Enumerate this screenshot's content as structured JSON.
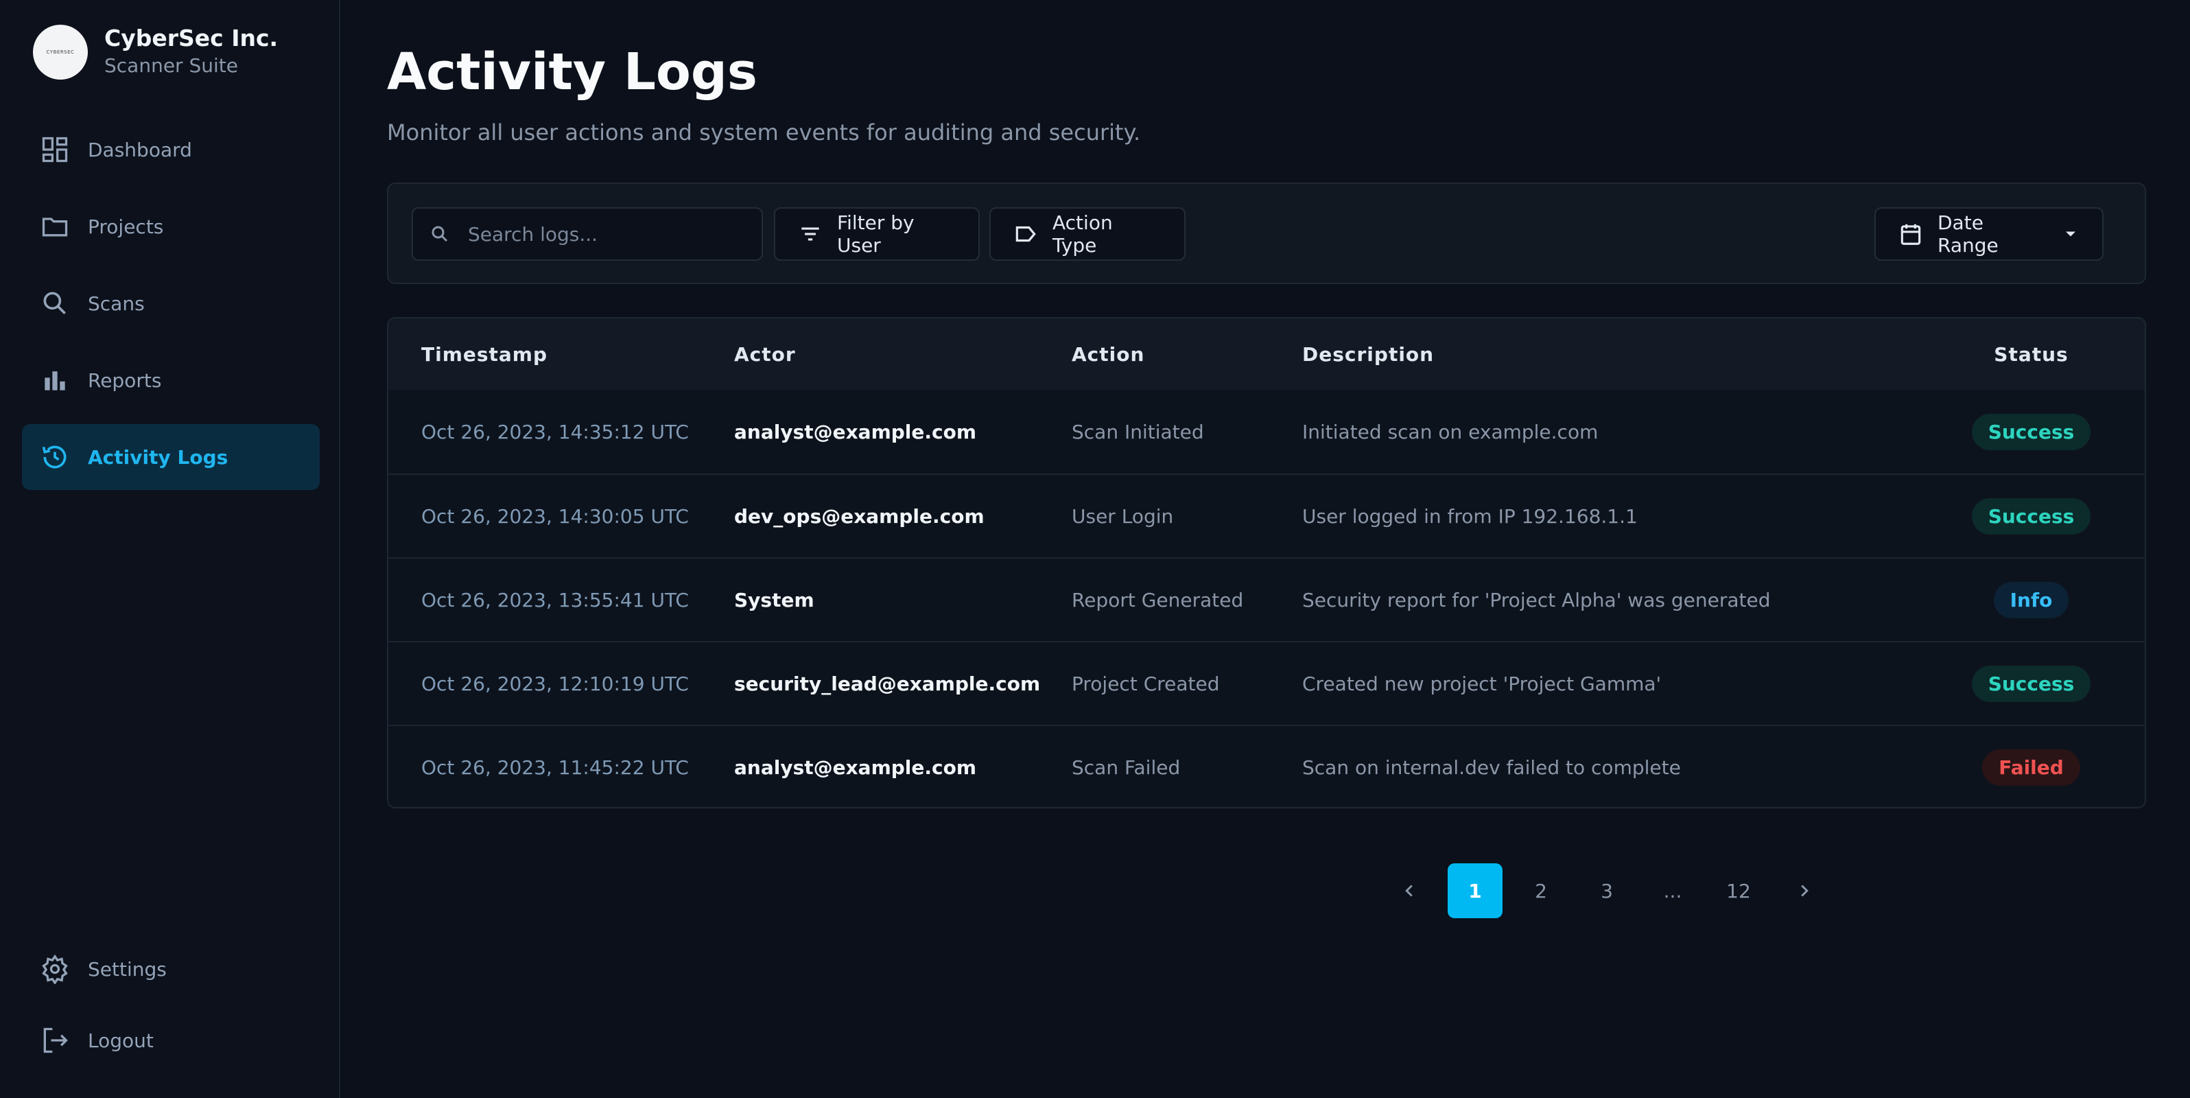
{
  "brand": {
    "name": "CyberSec Inc.",
    "subtitle": "Scanner Suite",
    "logo_text": "CYBERSEC"
  },
  "sidebar": {
    "items": [
      {
        "label": "Dashboard",
        "icon": "dashboard-icon",
        "active": false
      },
      {
        "label": "Projects",
        "icon": "folder-icon",
        "active": false
      },
      {
        "label": "Scans",
        "icon": "search-icon",
        "active": false
      },
      {
        "label": "Reports",
        "icon": "bar-chart-icon",
        "active": false
      },
      {
        "label": "Activity Logs",
        "icon": "history-icon",
        "active": true
      }
    ],
    "bottom": [
      {
        "label": "Settings",
        "icon": "gear-icon"
      },
      {
        "label": "Logout",
        "icon": "logout-icon"
      }
    ]
  },
  "page": {
    "title": "Activity Logs",
    "subtitle": "Monitor all user actions and system events for auditing and security."
  },
  "toolbar": {
    "search_placeholder": "Search logs...",
    "filter_user_label": "Filter by User",
    "action_type_label": "Action Type",
    "date_range_label": "Date Range"
  },
  "table": {
    "headers": {
      "timestamp": "Timestamp",
      "actor": "Actor",
      "action": "Action",
      "description": "Description",
      "status": "Status"
    },
    "rows": [
      {
        "timestamp": "Oct 26, 2023, 14:35:12 UTC",
        "actor": "analyst@example.com",
        "action": "Scan Initiated",
        "description": "Initiated scan on example.com",
        "status": "Success",
        "status_type": "success"
      },
      {
        "timestamp": "Oct 26, 2023, 14:30:05 UTC",
        "actor": "dev_ops@example.com",
        "action": "User Login",
        "description": "User logged in from IP 192.168.1.1",
        "status": "Success",
        "status_type": "success"
      },
      {
        "timestamp": "Oct 26, 2023, 13:55:41 UTC",
        "actor": "System",
        "action": "Report Generated",
        "description": "Security report for 'Project Alpha' was generated",
        "status": "Info",
        "status_type": "info"
      },
      {
        "timestamp": "Oct 26, 2023, 12:10:19 UTC",
        "actor": "security_lead@example.com",
        "action": "Project Created",
        "description": "Created new project 'Project Gamma'",
        "status": "Success",
        "status_type": "success"
      },
      {
        "timestamp": "Oct 26, 2023, 11:45:22 UTC",
        "actor": "analyst@example.com",
        "action": "Scan Failed",
        "description": "Scan on internal.dev failed to complete",
        "status": "Failed",
        "status_type": "failed"
      }
    ]
  },
  "pagination": {
    "pages": [
      "1",
      "2",
      "3"
    ],
    "ellipsis": "...",
    "last": "12",
    "current": "1"
  },
  "colors": {
    "accent": "#00b9f2",
    "success": "#2dd4bf",
    "info": "#38bdf8",
    "failed": "#f05252",
    "background": "#0b101a"
  }
}
